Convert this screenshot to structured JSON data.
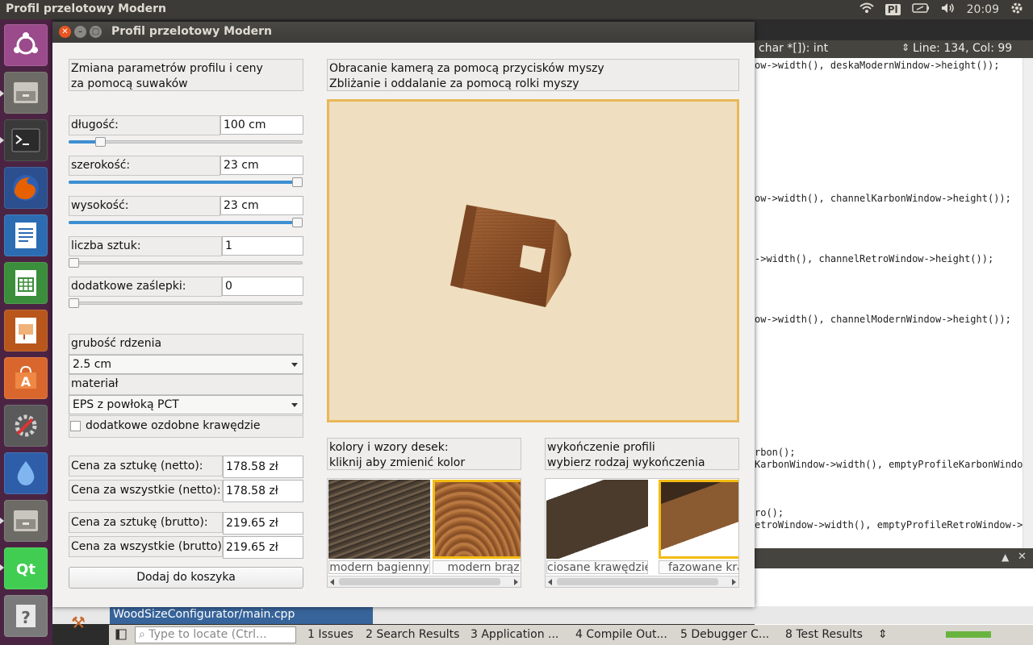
{
  "top_panel": {
    "title": "Profil przelotowy Modern",
    "keyboard_layout": "Pl",
    "time": "20:09"
  },
  "launcher": {
    "items": [
      "dash",
      "files",
      "terminal",
      "firefox",
      "writer",
      "calc",
      "impress",
      "software-center",
      "system-settings",
      "drop",
      "files-2",
      "qt-creator",
      "help"
    ]
  },
  "window": {
    "title": "Profil przelotowy Modern",
    "sliders_help": "Zmiana parametrów profilu i ceny\nza pomocą suwaków",
    "camera_help": "Obracanie kamerą za pomocą przycisków myszy\nZbliżanie i oddalanie za pomocą rolki myszy",
    "params": [
      {
        "label": "długość:",
        "value": "100 cm",
        "level": 0.12
      },
      {
        "label": "szerokość:",
        "value": "23 cm",
        "level": 1.0
      },
      {
        "label": "wysokość:",
        "value": "23 cm",
        "level": 1.0
      },
      {
        "label": "liczba sztuk:",
        "value": "1",
        "level": 0.0
      },
      {
        "label": "dodatkowe zaślepki:",
        "value": "0",
        "level": 0.0
      }
    ],
    "core_thickness": {
      "label": "grubość rdzenia",
      "value": "2.5 cm"
    },
    "material": {
      "label": "materiał",
      "value": "EPS z powłoką PCT"
    },
    "extra_edges": {
      "label": "dodatkowe ozdobne krawędzie",
      "checked": false
    },
    "prices": [
      {
        "label": "Cena za sztukę (netto):",
        "value": "178.58 zł"
      },
      {
        "label": "Cena za wszystkie (netto):",
        "value": "178.58 zł"
      },
      {
        "label": "Cena za sztukę (brutto):",
        "value": "219.65 zł"
      },
      {
        "label": "Cena za wszystkie (brutto):",
        "value": "219.65 zł"
      }
    ],
    "add_to_cart": "Dodaj do koszyka",
    "colors": {
      "header": "kolory i wzory desek:\nkliknij aby zmienić kolor",
      "items": [
        {
          "name": "modern bagienny",
          "selected": false
        },
        {
          "name": "modern brąz",
          "selected": true
        }
      ]
    },
    "finish": {
      "header": "wykończenie profili\nwybierz rodzaj wykończenia",
      "items": [
        {
          "name": "ciosane krawędzie",
          "selected": false
        },
        {
          "name": "fazowane krav",
          "selected": true
        }
      ]
    }
  },
  "ide": {
    "signature": "char *[]): int",
    "position": "Line: 134, Col: 99",
    "code_lines": [
      "ow->width(), deskaModernWindow->height());",
      "ow->width(), channelKarbonWindow->height());",
      "->width(), channelRetroWindow->height());",
      "ow->width(), channelModernWindow->height());",
      "rbon();",
      "KarbonWindow->width(), emptyProfileKarbonWindo",
      "ro();",
      "etroWindow->width(), emptyProfileRetroWindow->"
    ],
    "current_file": "WoodSizeConfigurator/main.cpp",
    "locate_placeholder": "Type to locate (Ctrl...",
    "tabs": [
      "1  Issues",
      "2  Search Results",
      "3  Application ...",
      "4  Compile Out...",
      "5  Debugger C...",
      "8  Test Results"
    ]
  },
  "colors": {
    "accent_selected": "#f4bb12",
    "viewport_bg": "#efdfc0",
    "viewport_border": "#e9b757",
    "slider_fill": "#3d8fd1",
    "launcher_bg": "#4b2443"
  }
}
